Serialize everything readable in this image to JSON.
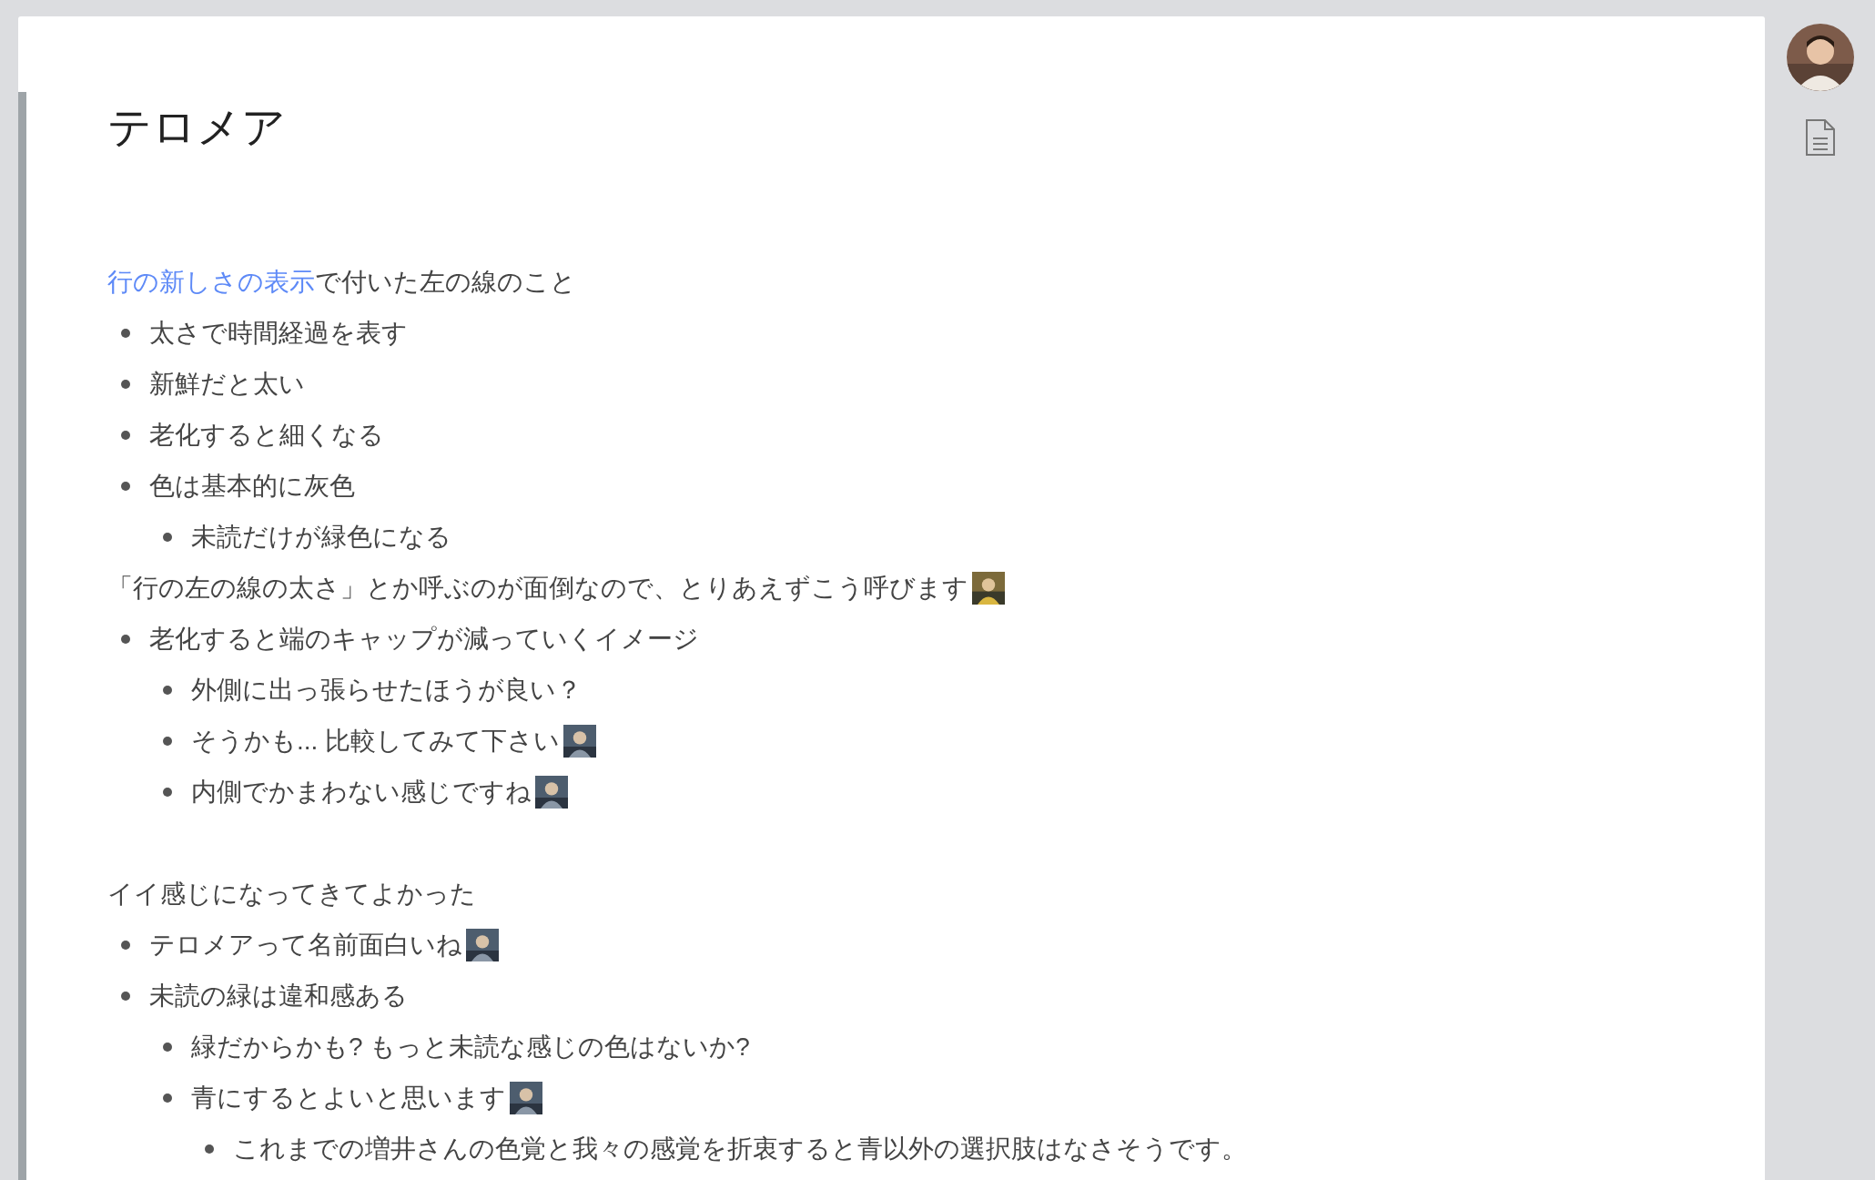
{
  "page": {
    "title": "テロメア"
  },
  "sections": [
    {
      "paragraphs": [
        {
          "link": "行の新しさの表示",
          "text": "で付いた左の線のこと",
          "bullets": [
            {
              "text": "太さで時間経過を表す"
            },
            {
              "text": "新鮮だと太い"
            },
            {
              "text": "老化すると細くなる"
            },
            {
              "text": "色は基本的に灰色",
              "children": [
                {
                  "text": "未読だけが緑色になる"
                }
              ]
            }
          ]
        },
        {
          "text": "「行の左の線の太さ」とか呼ぶのが面倒なので、とりあえずこう呼びます",
          "picture": true,
          "bullets": [
            {
              "text": "老化すると端のキャップが減っていくイメージ",
              "children": [
                {
                  "text": "外側に出っ張らせたほうが良い？"
                },
                {
                  "text": "そうかも... 比較してみて下さい",
                  "picture": true
                },
                {
                  "text": "内側でかまわない感じですね",
                  "picture": true
                }
              ]
            }
          ]
        }
      ]
    },
    {
      "paragraphs": [
        {
          "text": "イイ感じになってきてよかった",
          "bullets": [
            {
              "text": "テロメアって名前面白いね",
              "picture": true
            },
            {
              "text": "未読の緑は違和感ある",
              "children": [
                {
                  "text": "緑だからかも? もっと未読な感じの色はないか?"
                },
                {
                  "text": "青にするとよいと思います",
                  "picture": true,
                  "children": [
                    {
                      "text": "これまでの増井さんの色覚と我々の感覚を折衷すると青以外の選択肢はなさそうです。"
                    }
                  ]
                }
              ]
            }
          ]
        }
      ]
    }
  ]
}
